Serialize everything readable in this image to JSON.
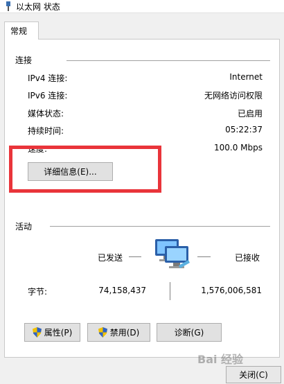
{
  "window": {
    "title": "以太网 状态"
  },
  "tabs": [
    {
      "label": "常规"
    }
  ],
  "connection": {
    "group_title": "连接",
    "rows": [
      {
        "label": "IPv4 连接:",
        "value": "Internet"
      },
      {
        "label": "IPv6 连接:",
        "value": "无网络访问权限"
      },
      {
        "label": "媒体状态:",
        "value": "已启用"
      },
      {
        "label": "持续时间:",
        "value": "05:22:37"
      },
      {
        "label": "速度:",
        "value": "100.0 Mbps"
      }
    ],
    "details_button": "详细信息(E)..."
  },
  "activity": {
    "group_title": "活动",
    "sent_label": "已发送",
    "received_label": "已接收",
    "bytes_label": "字节:",
    "bytes_sent": "74,158,437",
    "bytes_received": "1,576,006,581"
  },
  "buttons": {
    "properties": "属性(P)",
    "disable": "禁用(D)",
    "diagnose": "诊断(G)",
    "close": "关闭(C)"
  },
  "watermark": "Bai 经验",
  "colors": {
    "highlight": "#e9343a",
    "panel": "#ffffff",
    "background": "#f0f0f0"
  }
}
